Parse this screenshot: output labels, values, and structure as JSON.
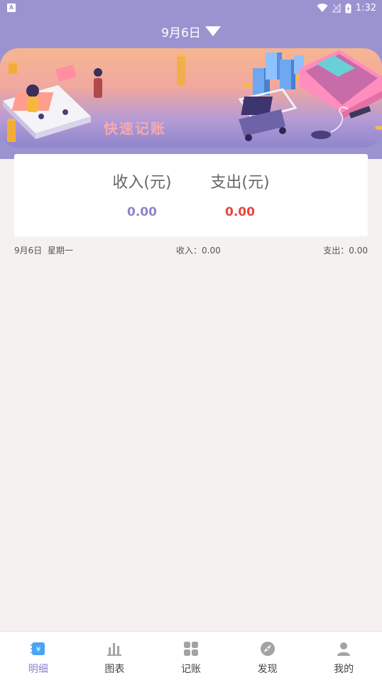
{
  "status_bar": {
    "notification_badge": "A",
    "time": "1:32"
  },
  "header": {
    "date": "9月6日",
    "banner_text": "快速记账"
  },
  "summary": {
    "income_label": "收入(元)",
    "income_value": "0.00",
    "expense_label": "支出(元)",
    "expense_value": "0.00",
    "income_color": "#8e86c4",
    "expense_color": "#e8453c"
  },
  "day_row": {
    "date_weekday": "9月6日  星期一",
    "income": "收入：0.00",
    "expense": "支出：0.00"
  },
  "tabs": [
    {
      "label": "明细",
      "icon": "detail-icon",
      "active": true
    },
    {
      "label": "图表",
      "icon": "chart-icon",
      "active": false
    },
    {
      "label": "记账",
      "icon": "record-icon",
      "active": false
    },
    {
      "label": "发现",
      "icon": "discover-icon",
      "active": false
    },
    {
      "label": "我的",
      "icon": "profile-icon",
      "active": false
    }
  ],
  "colors": {
    "header_bg": "#9b93cf",
    "accent": "#8b7fcf",
    "page_bg": "#f5f1f1"
  }
}
